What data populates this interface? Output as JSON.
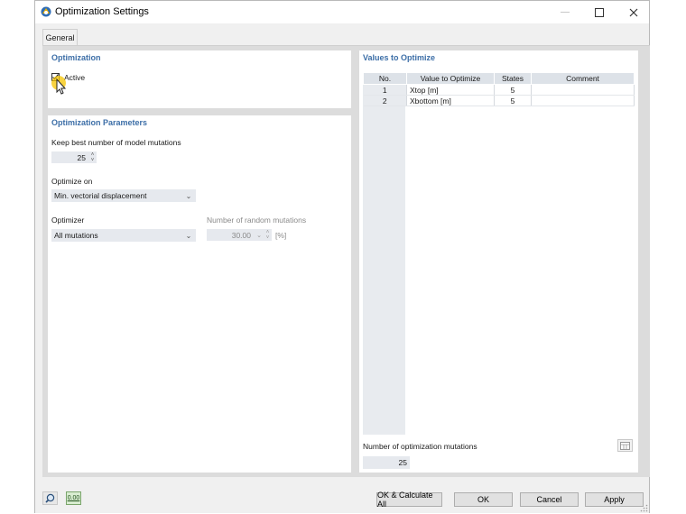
{
  "window": {
    "title": "Optimization Settings",
    "minimize_icon": "minimize-icon",
    "maximize_icon": "maximize-icon",
    "close_icon": "close-icon"
  },
  "tabs": [
    {
      "label": "General",
      "selected": true
    }
  ],
  "optimization": {
    "title": "Optimization",
    "active_label": "Active",
    "active_checked": true
  },
  "parameters": {
    "title": "Optimization Parameters",
    "keep_best_label": "Keep best number of model mutations",
    "keep_best_value": "25",
    "optimize_on_label": "Optimize on",
    "optimize_on_value": "Min. vectorial displacement",
    "optimizer_label": "Optimizer",
    "optimizer_value": "All mutations",
    "random_mutations_label": "Number of random mutations",
    "random_mutations_value": "30.00",
    "random_mutations_unit": "[%]"
  },
  "values_to_optimize": {
    "title": "Values to Optimize",
    "columns": [
      "No.",
      "Value to Optimize",
      "States",
      "Comment"
    ],
    "rows": [
      {
        "no": "1",
        "value": "Xtop [m]",
        "states": "5",
        "comment": ""
      },
      {
        "no": "2",
        "value": "Xbottom [m]",
        "states": "5",
        "comment": ""
      }
    ],
    "mutations_label": "Number of optimization mutations",
    "mutations_value": "25"
  },
  "footer": {
    "units_icon_text": "0.00",
    "ok_calc_label": "OK & Calculate All",
    "ok_label": "OK",
    "cancel_label": "Cancel",
    "apply_label": "Apply"
  },
  "colors": {
    "section_title": "#3c6ea7",
    "field_bg": "#e6e9ee",
    "header_bg": "#dde2e8",
    "cursor_highlight": "#f5c400"
  }
}
